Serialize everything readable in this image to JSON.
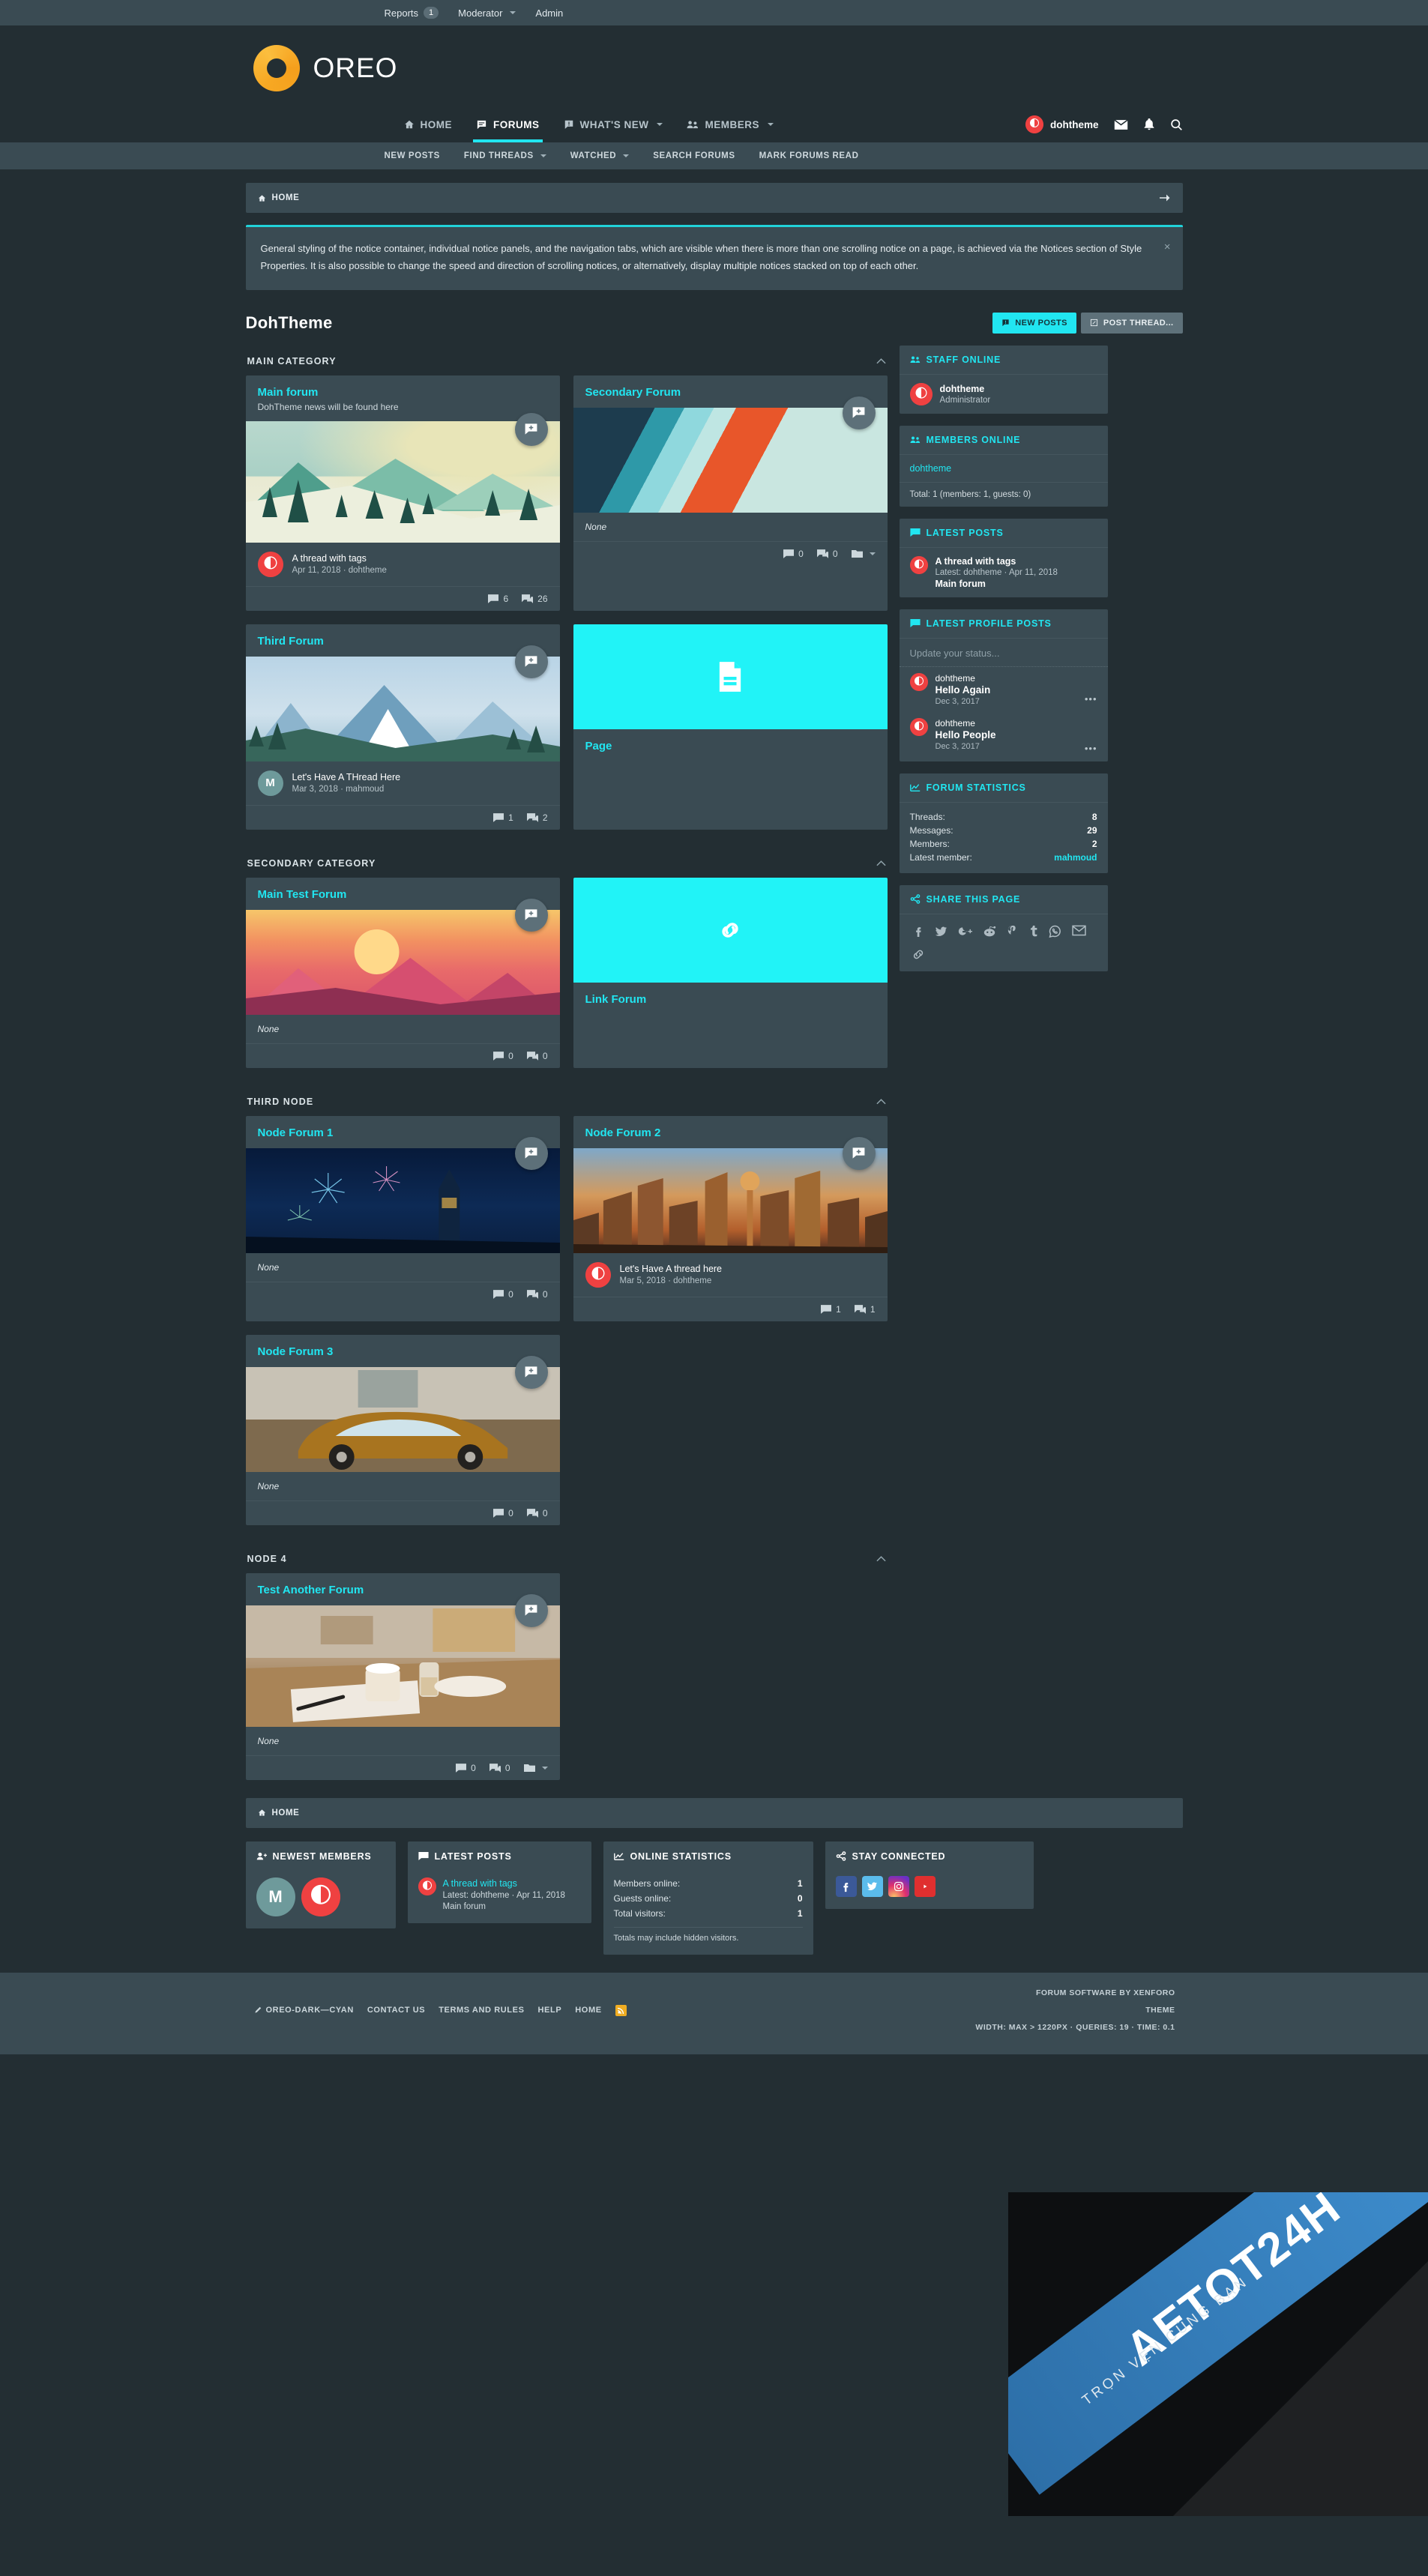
{
  "staffbar": {
    "items": [
      {
        "label": "Reports",
        "badge": "1",
        "caret": false
      },
      {
        "label": "Moderator",
        "badge": null,
        "caret": true
      },
      {
        "label": "Admin",
        "badge": null,
        "caret": false
      }
    ]
  },
  "brand": {
    "name": "OREO"
  },
  "mainnav": {
    "items": [
      {
        "label": "HOME",
        "icon": "home-icon",
        "caret": false,
        "active": false
      },
      {
        "label": "FORUMS",
        "icon": "forums-icon",
        "caret": false,
        "active": true
      },
      {
        "label": "WHAT'S NEW",
        "icon": "whats-new-icon",
        "caret": true,
        "active": false
      },
      {
        "label": "MEMBERS",
        "icon": "members-icon",
        "caret": true,
        "active": false
      }
    ],
    "user": "dohtheme",
    "icons": [
      "inbox-icon",
      "bell-icon",
      "search-icon"
    ]
  },
  "subnav": {
    "items": [
      {
        "label": "NEW POSTS",
        "caret": false
      },
      {
        "label": "FIND THREADS",
        "caret": true
      },
      {
        "label": "WATCHED",
        "caret": true
      },
      {
        "label": "SEARCH FORUMS",
        "caret": false
      },
      {
        "label": "MARK FORUMS READ",
        "caret": false
      }
    ]
  },
  "breadcrumb": {
    "home": "HOME"
  },
  "notice": {
    "text": "General styling of the notice container, individual notice panels, and the navigation tabs, which are visible when there is more than one scrolling notice on a page, is achieved via the Notices section of Style Properties. It is also possible to change the speed and direction of scrolling notices, or alternatively, display multiple notices stacked on top of each other.",
    "close": "×"
  },
  "page": {
    "title": "DohTheme",
    "new_posts_button": "NEW POSTS",
    "post_thread_button": "POST THREAD..."
  },
  "categories": [
    {
      "title": "MAIN CATEGORY",
      "nodes": [
        {
          "name": "Main forum",
          "desc": "DohTheme news will be found here",
          "art": "art-forest",
          "banner_h": "h162",
          "last": {
            "title": "A thread with tags",
            "meta": "Apr 11, 2018 · dohtheme",
            "avatar": "dohtheme",
            "avatar_kind": "red"
          },
          "none": null,
          "stats": [
            {
              "icon": "thread-icon",
              "value": "6"
            },
            {
              "icon": "message-icon",
              "value": "26"
            }
          ],
          "folder": false
        },
        {
          "name": "Secondary Forum",
          "desc": null,
          "art": "art-geo",
          "banner_h": "h140",
          "last": null,
          "none": "None",
          "stats": [
            {
              "icon": "thread-icon",
              "value": "0"
            },
            {
              "icon": "message-icon",
              "value": "0"
            }
          ],
          "folder": true
        },
        {
          "name": "Third Forum",
          "desc": null,
          "art": "art-mount",
          "banner_h": "h140",
          "last": {
            "title": "Let's Have A THread Here",
            "meta": "Mar 3, 2018 · mahmoud",
            "avatar": "M",
            "avatar_kind": "teal"
          },
          "none": null,
          "stats": [
            {
              "icon": "thread-icon",
              "value": "1"
            },
            {
              "icon": "message-icon",
              "value": "2"
            }
          ],
          "folder": false
        },
        {
          "name": "Page",
          "desc": null,
          "art": "art-cyan",
          "banner_h": "h140",
          "page_icon": "page-icon",
          "title_below": true,
          "last": null,
          "none": null,
          "stats": [],
          "folder": false
        }
      ]
    },
    {
      "title": "SECONDARY CATEGORY",
      "nodes": [
        {
          "name": "Main Test Forum",
          "desc": null,
          "art": "art-sunset",
          "banner_h": "h140",
          "last": null,
          "none": "None",
          "stats": [
            {
              "icon": "thread-icon",
              "value": "0"
            },
            {
              "icon": "message-icon",
              "value": "0"
            }
          ],
          "folder": false
        },
        {
          "name": "Link Forum",
          "desc": null,
          "art": "art-cyan",
          "banner_h": "h140",
          "page_icon": "link-icon",
          "title_below": true,
          "last": null,
          "none": null,
          "stats": [],
          "folder": false
        }
      ]
    },
    {
      "title": "THIRD NODE",
      "nodes": [
        {
          "name": "Node Forum 1",
          "desc": null,
          "art": "art-fire",
          "banner_h": "h140",
          "last": null,
          "none": "None",
          "stats": [
            {
              "icon": "thread-icon",
              "value": "0"
            },
            {
              "icon": "message-icon",
              "value": "0"
            }
          ],
          "folder": false
        },
        {
          "name": "Node Forum 2",
          "desc": null,
          "art": "art-city",
          "banner_h": "h140",
          "last": {
            "title": "Let's Have A thread here",
            "meta": "Mar 5, 2018 · dohtheme",
            "avatar": "dohtheme",
            "avatar_kind": "red"
          },
          "none": null,
          "stats": [
            {
              "icon": "thread-icon",
              "value": "1"
            },
            {
              "icon": "message-icon",
              "value": "1"
            }
          ],
          "folder": false
        },
        {
          "name": "Node Forum 3",
          "desc": null,
          "art": "art-car",
          "banner_h": "h140",
          "last": null,
          "none": "None",
          "stats": [
            {
              "icon": "thread-icon",
              "value": "0"
            },
            {
              "icon": "message-icon",
              "value": "0"
            }
          ],
          "folder": false
        }
      ]
    },
    {
      "title": "NODE 4",
      "nodes": [
        {
          "name": "Test Another Forum",
          "desc": null,
          "art": "art-desk",
          "banner_h": "h162",
          "last": null,
          "none": "None",
          "stats": [
            {
              "icon": "thread-icon",
              "value": "0"
            },
            {
              "icon": "message-icon",
              "value": "0"
            }
          ],
          "folder": true
        }
      ]
    }
  ],
  "sidebar": {
    "staff_online": {
      "title": "STAFF ONLINE",
      "members": [
        {
          "name": "dohtheme",
          "role": "Administrator"
        }
      ]
    },
    "members_online": {
      "title": "MEMBERS ONLINE",
      "names": [
        "dohtheme"
      ],
      "total": "Total: 1 (members: 1, guests: 0)"
    },
    "latest_posts": {
      "title": "LATEST POSTS",
      "items": [
        {
          "title": "A thread with tags",
          "meta": "Latest: dohtheme · Apr 11, 2018",
          "forum": "Main forum"
        }
      ]
    },
    "latest_profile_posts": {
      "title": "LATEST PROFILE POSTS",
      "placeholder": "Update your status...",
      "items": [
        {
          "user": "dohtheme",
          "message": "Hello Again",
          "date": "Dec 3, 2017",
          "more": "•••"
        },
        {
          "user": "dohtheme",
          "message": "Hello People",
          "date": "Dec 3, 2017",
          "more": "•••"
        }
      ]
    },
    "forum_statistics": {
      "title": "FORUM STATISTICS",
      "rows": [
        {
          "label": "Threads:",
          "value": "8",
          "accent": false
        },
        {
          "label": "Messages:",
          "value": "29",
          "accent": false
        },
        {
          "label": "Members:",
          "value": "2",
          "accent": false
        },
        {
          "label": "Latest member:",
          "value": "mahmoud",
          "accent": true
        }
      ]
    },
    "share_this_page": {
      "title": "SHARE THIS PAGE",
      "icons": [
        "facebook-icon",
        "twitter-icon",
        "google-plus-icon",
        "reddit-icon",
        "pinterest-icon",
        "tumblr-icon",
        "whatsapp-icon",
        "email-icon",
        "link-icon"
      ]
    }
  },
  "bottom_breadcrumb": {
    "home": "HOME"
  },
  "bottom_widgets": {
    "newest_members": {
      "title": "NEWEST MEMBERS",
      "members": [
        {
          "name": "M",
          "kind": "teal"
        },
        {
          "name": "dohtheme",
          "kind": "red"
        }
      ]
    },
    "latest_posts": {
      "title": "LATEST POSTS",
      "items": [
        {
          "title": "A thread with tags",
          "meta": "Latest: dohtheme · Apr 11, 2018",
          "forum": "Main forum"
        }
      ]
    },
    "online_statistics": {
      "title": "ONLINE STATISTICS",
      "rows": [
        {
          "label": "Members online:",
          "value": "1"
        },
        {
          "label": "Guests online:",
          "value": "0"
        },
        {
          "label": "Total visitors:",
          "value": "1"
        }
      ],
      "footnote": "Totals may include hidden visitors."
    },
    "stay_connected": {
      "title": "STAY CONNECTED",
      "icons": [
        "facebook-icon",
        "twitter-icon",
        "instagram-icon",
        "youtube-icon"
      ]
    }
  },
  "footer": {
    "left_links": [
      "OREO-DARK—CYAN",
      "CONTACT US",
      "TERMS AND RULES",
      "HELP",
      "HOME"
    ],
    "rss_icon": "rss-icon",
    "style_icon": "paintbrush-icon",
    "right_lines": [
      "FORUM SOFTWARE BY XENFORO",
      "THEME",
      "WIDTH: MAX > 1220PX · QUERIES: 19 · TIME: 0.1"
    ]
  },
  "watermark": {
    "title": "AETOT24H",
    "subtitle": "TRỌN VẸN CÙNG BẠN"
  }
}
